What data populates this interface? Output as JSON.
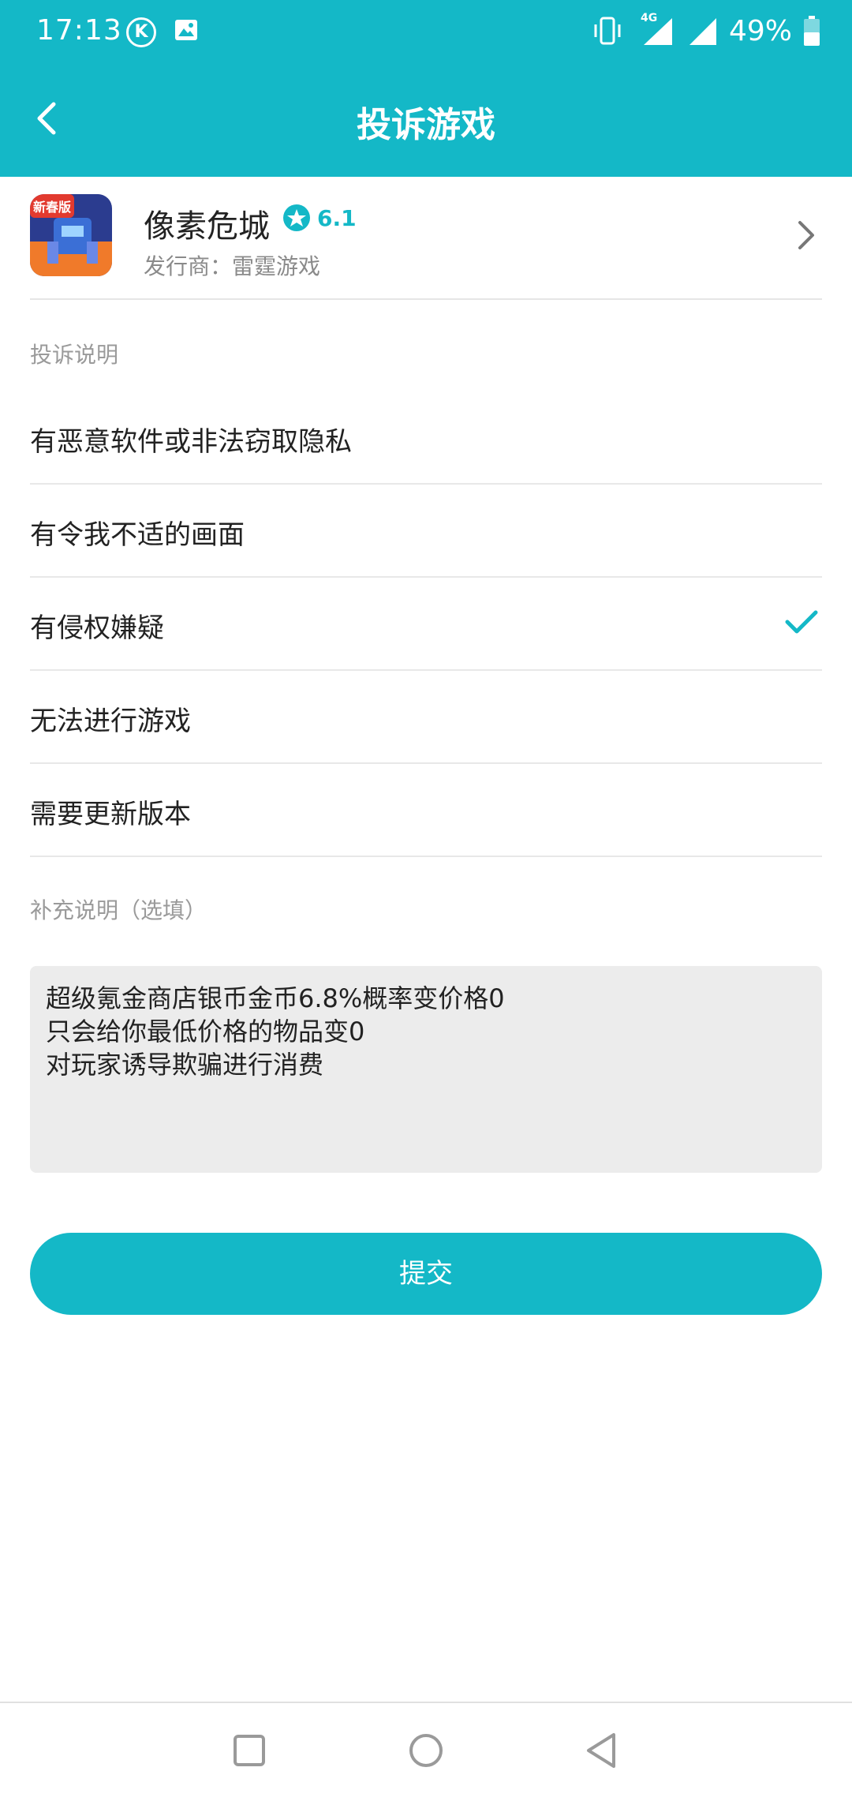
{
  "status_bar": {
    "time": "17:13",
    "battery": "49%",
    "network": "4G",
    "k_badge": "K"
  },
  "header": {
    "title": "投诉游戏"
  },
  "game": {
    "name": "像素危城",
    "rating": "6.1",
    "publisher": "发行商：雷霆游戏",
    "icon_badge": "新春版"
  },
  "complaint": {
    "label": "投诉说明",
    "options": [
      {
        "label": "有恶意软件或非法窃取隐私",
        "selected": false
      },
      {
        "label": "有令我不适的画面",
        "selected": false
      },
      {
        "label": "有侵权嫌疑",
        "selected": true
      },
      {
        "label": "无法进行游戏",
        "selected": false
      },
      {
        "label": "需要更新版本",
        "selected": false
      }
    ]
  },
  "supplement": {
    "label": "补充说明（选填）",
    "value": "超级氪金商店银币金币6.8%概率变价格0\n只会给你最低价格的物品变0\n对玩家诱导欺骗进行消费"
  },
  "submit_label": "提交",
  "colors": {
    "accent": "#14b8c7",
    "input_bg": "#ececec"
  }
}
